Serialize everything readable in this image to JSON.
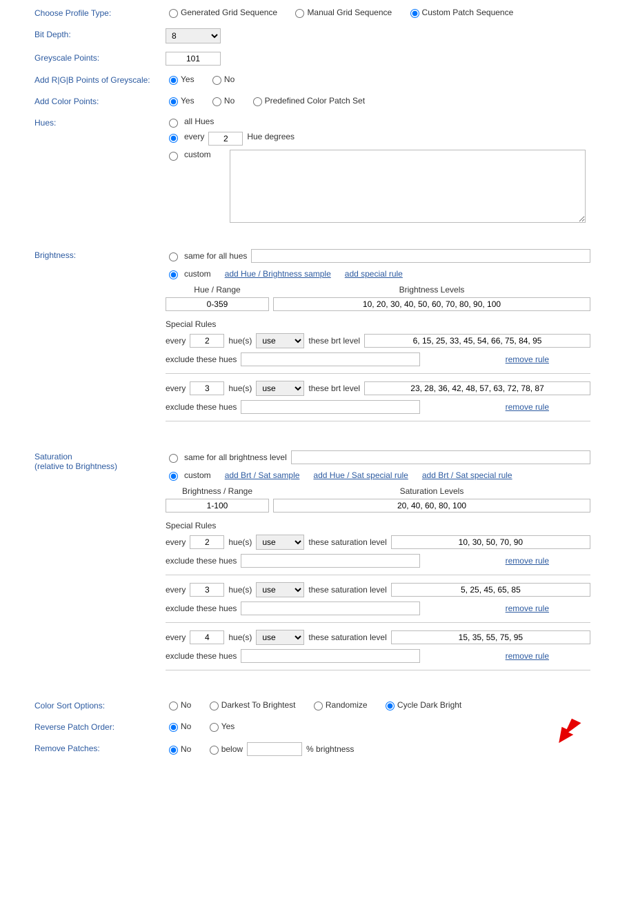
{
  "profileType": {
    "label": "Choose Profile Type:",
    "options": [
      "Generated Grid Sequence",
      "Manual Grid Sequence",
      "Custom Patch Sequence"
    ],
    "selected": 2
  },
  "bitDepth": {
    "label": "Bit Depth:",
    "value": "8"
  },
  "greyscale": {
    "label": "Greyscale Points:",
    "value": "101"
  },
  "rgbPoints": {
    "label": "Add R|G|B Points of Greyscale:",
    "yes": "Yes",
    "no": "No",
    "selected": "yes"
  },
  "colorPoints": {
    "label": "Add Color Points:",
    "options": [
      "Yes",
      "No",
      "Predefined Color Patch Set"
    ],
    "selected": 0
  },
  "hues": {
    "label": "Hues:",
    "allLabel": "all Hues",
    "everyLabel": "every",
    "everyValue": "2",
    "everySuffix": "Hue degrees",
    "customLabel": "custom",
    "selected": "every"
  },
  "brightness": {
    "label": "Brightness:",
    "sameLabel": "same for all hues",
    "customLabel": "custom",
    "selected": "custom",
    "addSample": "add Hue / Brightness sample",
    "addRule": "add special rule",
    "hueRangeHdr": "Hue / Range",
    "levelsHdr": "Brightness Levels",
    "hueRange": "0-359",
    "levels": "10, 20, 30, 40, 50, 60, 70, 80, 90, 100",
    "specialRulesHdr": "Special Rules",
    "everyTxt": "every",
    "huesTxt": "hue(s)",
    "useOpt": "use",
    "brtLevelTxt": "these brt level",
    "excludeTxt": "exclude these hues",
    "removeTxt": "remove rule",
    "rules": [
      {
        "every": "2",
        "levels": "6, 15, 25, 33, 45, 54, 66, 75, 84, 95"
      },
      {
        "every": "3",
        "levels": "23, 28, 36, 42, 48, 57, 63, 72, 78, 87"
      }
    ]
  },
  "saturation": {
    "label1": "Saturation",
    "label2": "(relative to Brightness)",
    "sameLabel": "same for all brightness level",
    "customLabel": "custom",
    "selected": "custom",
    "addSample": "add Brt / Sat sample",
    "addHueRule": "add Hue / Sat special rule",
    "addBrtRule": "add Brt / Sat special rule",
    "brtRangeHdr": "Brightness / Range",
    "levelsHdr": "Saturation Levels",
    "brtRange": "1-100",
    "levels": "20, 40, 60, 80, 100",
    "specialRulesHdr": "Special Rules",
    "satLevelTxt": "these saturation level",
    "rules": [
      {
        "every": "2",
        "levels": "10, 30, 50, 70, 90"
      },
      {
        "every": "3",
        "levels": "5, 25, 45, 65, 85"
      },
      {
        "every": "4",
        "levels": "15, 35, 55, 75, 95"
      }
    ]
  },
  "colorSort": {
    "label": "Color Sort Options:",
    "options": [
      "No",
      "Darkest To Brightest",
      "Randomize",
      "Cycle Dark Bright"
    ],
    "selected": 3
  },
  "reversePatch": {
    "label": "Reverse Patch Order:",
    "no": "No",
    "yes": "Yes",
    "selected": "no"
  },
  "removePatches": {
    "label": "Remove Patches:",
    "noLabel": "No",
    "belowLabel": "below",
    "suffix": "% brightness",
    "selected": "no"
  }
}
